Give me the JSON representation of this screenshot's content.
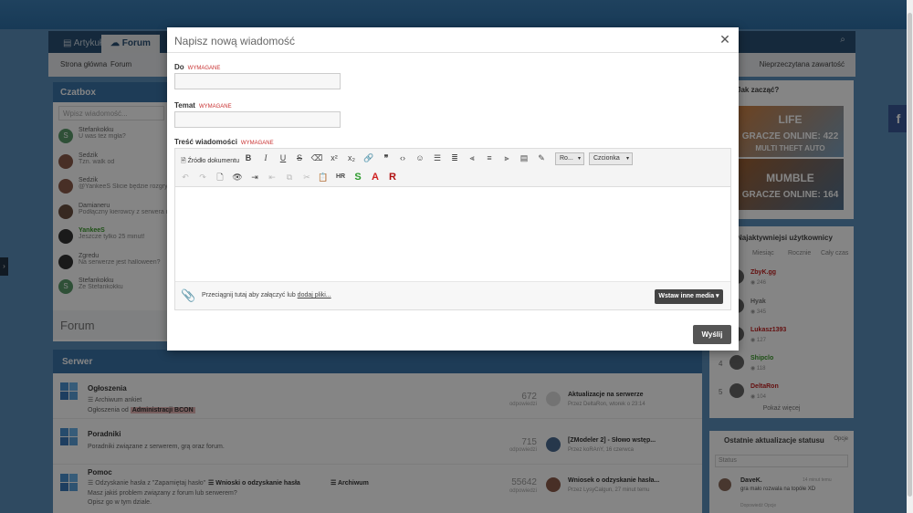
{
  "nav": {
    "tabs": [
      {
        "label": "Artykuły"
      },
      {
        "label": "Forum"
      }
    ]
  },
  "breadcrumb": {
    "items": [
      "Strona główna",
      "Forum"
    ],
    "unread": "Nieprzeczytana zawartość"
  },
  "czatbox": {
    "title": "Czatbox",
    "input_placeholder": "Wpisz wiadomość...",
    "items": [
      {
        "name": "Stefankokku",
        "msg": "U was też mgła?"
      },
      {
        "name": "Sedzik",
        "msg": "Tzn. walk od"
      },
      {
        "name": "Sedzik",
        "msg": "@YankeeS Ślicie będzie rozgrywka w"
      },
      {
        "name": "Damianeru",
        "msg": "Podłączny kierowcy z serwera map"
      },
      {
        "name": "YankeeS",
        "msg": "Jeszcze tylko 25 minut!"
      },
      {
        "name": "Zgredu",
        "msg": "Na serwerze jest halloween?"
      },
      {
        "name": "Stefankokku",
        "msg": "Ze Stefankokku"
      }
    ]
  },
  "forum_title": "Forum",
  "serwer": {
    "title": "Serwer",
    "rows": [
      {
        "title": "Ogłoszenia",
        "sub1": "Archiwum ankiet",
        "sub2_prefix": "Ogłoszenia od",
        "sub2_highlight": "Administracji BCON",
        "count": "672",
        "count_label": "odpowiedzi",
        "last_title": "Aktualizacje na serwerze",
        "last_meta": "Przez DeltaRon, wtorek o 23:14"
      },
      {
        "title": "Poradniki",
        "sub1": "Poradniki związane z serwerem, grą oraz forum.",
        "count": "715",
        "count_label": "odpowiedzi",
        "last_title": "[ZModeler 2] - Słowo wstęp...",
        "last_meta": "Przez koRAnY, 16 czerwca"
      },
      {
        "title": "Pomoc",
        "sub1": "Odzyskanie hasła z \"Zapamiętaj hasło\"",
        "sub1b": "Wnioski o odzyskanie hasła",
        "sub1c": "Archiwum",
        "sub2": "Masz jakiś problem związany z forum lub serwerem?",
        "sub3": "Opisz go w tym dziale.",
        "count": "55642",
        "count_label": "odpowiedzi",
        "last_title": "Wniosek o odzyskanie hasła...",
        "last_meta": "Przez LysyCalgun, 27 minut temu"
      }
    ]
  },
  "right": {
    "help_title": "Jak zacząć?",
    "banner1": {
      "name": "LIFE",
      "sub": "MULTI THEFT AUTO",
      "players": "GRACZE ONLINE: 422"
    },
    "banner2": {
      "name": "MUMBLE",
      "players": "GRACZE ONLINE: 164"
    },
    "top_title": "Najaktywniejsi użytkownicy",
    "top_tabs": [
      "Miesiąc",
      "Rocznie",
      "Cały czas"
    ],
    "users": [
      {
        "rank": "",
        "name": "ZbyK.gg",
        "pts": "246",
        "color": "#c02020"
      },
      {
        "rank": "",
        "name": "Hyak",
        "pts": "345",
        "color": "#777777"
      },
      {
        "rank": "",
        "name": "Lukasz1393",
        "pts": "127",
        "color": "#c02020"
      },
      {
        "rank": "4",
        "name": "Shipclo",
        "pts": "118",
        "color": "#3a9a2a"
      },
      {
        "rank": "5",
        "name": "DeltaRon",
        "pts": "104",
        "color": "#c02020"
      }
    ],
    "show_more": "Pokaż więcej",
    "status_title": "Ostatnie aktualizacje statusu",
    "status_options": "Opcje",
    "status_placeholder": "Status",
    "status_user": "DaveK.",
    "status_time": "14 minut temu",
    "status_text": "gra mało rozwala na topółe XD",
    "status_foot": "Dopowiedź Opcje"
  },
  "modal": {
    "title": "Napisz nową wiadomość",
    "to_label": "Do",
    "subject_label": "Temat",
    "body_label": "Treść wiadomości",
    "required": "wymagane",
    "to_value": "",
    "subject_value": "",
    "toolbar": {
      "source": "Źródło dokumentu",
      "font_size": "Ro...",
      "font": "Czcionka"
    },
    "attach_text": "Przeciągnij tutaj aby załączyć lub",
    "attach_link": "dodaj pliki...",
    "media_button": "Wstaw inne media",
    "send_button": "Wyślij"
  }
}
